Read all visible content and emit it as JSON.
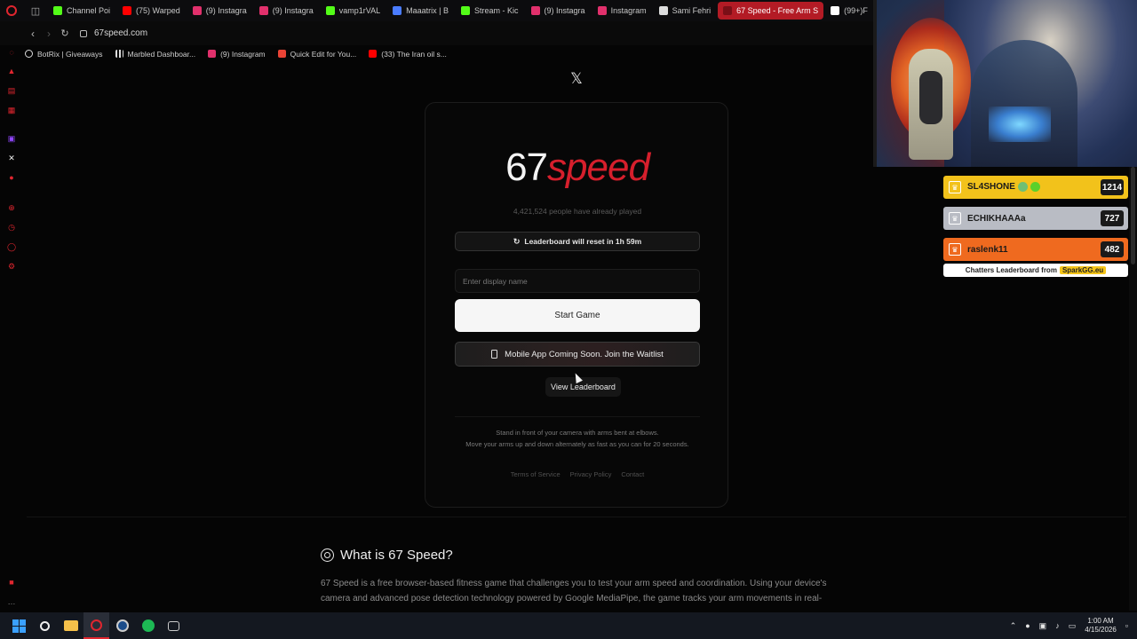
{
  "browser": {
    "tabs": [
      {
        "label": "Channel Poi",
        "icon": "kick-icon",
        "color": "#53fc18"
      },
      {
        "label": "(75) Warped",
        "icon": "youtube-icon",
        "color": "#ff0000"
      },
      {
        "label": "(9) Instagra",
        "icon": "instagram-icon",
        "color": "#e1306c"
      },
      {
        "label": "(9) Instagra",
        "icon": "instagram-icon",
        "color": "#e1306c"
      },
      {
        "label": "vamp1rVAL",
        "icon": "kick-icon",
        "color": "#53fc18"
      },
      {
        "label": "Maaatrix | B",
        "icon": "bookmark-b-icon",
        "color": "#4a7cff"
      },
      {
        "label": "Stream - Kic",
        "icon": "kick-icon",
        "color": "#53fc18"
      },
      {
        "label": "(9) Instagra",
        "icon": "instagram-icon",
        "color": "#e1306c"
      },
      {
        "label": "Instagram",
        "icon": "instagram-icon",
        "color": "#e1306c"
      },
      {
        "label": "Sami Fehri",
        "icon": "google-icon",
        "color": "#dddddd"
      },
      {
        "label": "67 Speed - Free Arm S",
        "icon": "67speed-icon",
        "color": "#b31b25",
        "active": true
      },
      {
        "label": "(99+)F",
        "icon": "tiktok-icon",
        "color": "#ffffff"
      }
    ],
    "url": "67speed.com",
    "bookmarks": [
      {
        "label": "BotRix | Giveaways",
        "color": "#dddddd"
      },
      {
        "label": "Marbled Dashboar...",
        "color": "#dddddd"
      },
      {
        "label": "(9) Instagram",
        "color": "#e1306c"
      },
      {
        "label": "Quick Edit for You...",
        "color": "#ea4335"
      },
      {
        "label": "(33) The Iran oil s...",
        "color": "#ff0000"
      }
    ]
  },
  "page": {
    "brand_num": "67",
    "brand_word": "speed",
    "played_text": "4,421,524 people have already played",
    "reset_text": "Leaderboard will reset in 1h 59m",
    "name_placeholder": "Enter display name",
    "start_label": "Start Game",
    "waitlist_label": "Mobile App Coming Soon. Join the Waitlist",
    "leaderboard_label": "View Leaderboard",
    "instruction_1": "Stand in front of your camera with arms bent at elbows.",
    "instruction_2": "Move your arms up and down alternately as fast as you can for 20 seconds.",
    "footer_links": [
      "Terms of Service",
      "Privacy Policy",
      "Contact"
    ],
    "what_title": "What is 67 Speed?",
    "what_text": "67 Speed is a free browser-based fitness game that challenges you to test your arm speed and coordination. Using your device's camera and advanced pose detection technology powered by Google MediaPipe, the game tracks your arm movements in real-"
  },
  "overlay": {
    "rows": [
      {
        "name": "SL4SHONE",
        "score": "1214",
        "color": "#f2c21b",
        "badges": true
      },
      {
        "name": "ECHIKHAAAa",
        "score": "727",
        "color": "#b9bcc4",
        "badges": false
      },
      {
        "name": "raslenk11",
        "score": "482",
        "color": "#ef6a1f",
        "badges": false
      }
    ],
    "footer_text": "Chatters Leaderboard from",
    "footer_brand": "SparkGG.eu"
  },
  "taskbar": {
    "time": "1:00 AM",
    "date": "4/15/2026"
  }
}
